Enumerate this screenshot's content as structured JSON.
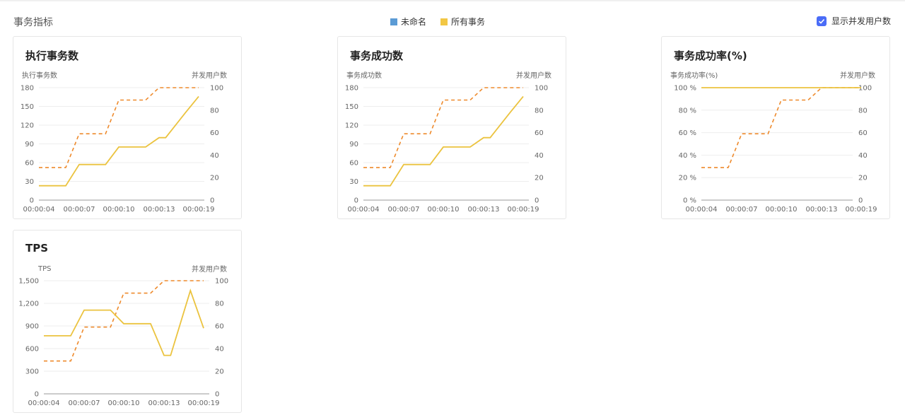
{
  "header": {
    "title": "事务指标",
    "legend": [
      {
        "label": "未命名",
        "color": "#5b9bd5"
      },
      {
        "label": "所有事务",
        "color": "#f2c744"
      }
    ],
    "toggle_label": "显示并发用户数",
    "toggle_checked": true
  },
  "colors": {
    "series_line": "#ebc33f",
    "users_line": "#ee8a2c",
    "grid": "#eeeeee",
    "axis": "#999999"
  },
  "chart_data": [
    {
      "type": "line",
      "title": "执行事务数",
      "ylabel": "执行事务数",
      "y2label": "并发用户数",
      "x": [
        "00:00:04",
        "00:00:07",
        "00:00:10",
        "00:00:13",
        "00:00:19"
      ],
      "ylim": [
        0,
        180
      ],
      "yticks": [
        "0",
        "30",
        "60",
        "90",
        "120",
        "150",
        "180"
      ],
      "y2lim": [
        0,
        100
      ],
      "y2ticks": [
        "0",
        "20",
        "40",
        "60",
        "80",
        "100"
      ],
      "series": {
        "points": [
          [
            4,
            23
          ],
          [
            6,
            23
          ],
          [
            7,
            57
          ],
          [
            9,
            57
          ],
          [
            10,
            85
          ],
          [
            12,
            85
          ],
          [
            13,
            100
          ],
          [
            14,
            100
          ],
          [
            17,
            140
          ],
          [
            19,
            166
          ]
        ]
      },
      "users": {
        "points": [
          [
            4,
            29
          ],
          [
            6,
            29
          ],
          [
            7,
            59
          ],
          [
            9,
            59
          ],
          [
            10,
            89
          ],
          [
            12,
            89
          ],
          [
            13,
            100
          ],
          [
            19,
            100
          ]
        ]
      }
    },
    {
      "type": "line",
      "title": "事务成功数",
      "ylabel": "事务成功数",
      "y2label": "并发用户数",
      "x": [
        "00:00:04",
        "00:00:07",
        "00:00:10",
        "00:00:13",
        "00:00:19"
      ],
      "ylim": [
        0,
        180
      ],
      "yticks": [
        "0",
        "30",
        "60",
        "90",
        "120",
        "150",
        "180"
      ],
      "y2lim": [
        0,
        100
      ],
      "y2ticks": [
        "0",
        "20",
        "40",
        "60",
        "80",
        "100"
      ],
      "series": {
        "points": [
          [
            4,
            23
          ],
          [
            6,
            23
          ],
          [
            7,
            57
          ],
          [
            9,
            57
          ],
          [
            10,
            85
          ],
          [
            12,
            85
          ],
          [
            13,
            100
          ],
          [
            14,
            100
          ],
          [
            17,
            140
          ],
          [
            19,
            166
          ]
        ]
      },
      "users": {
        "points": [
          [
            4,
            29
          ],
          [
            6,
            29
          ],
          [
            7,
            59
          ],
          [
            9,
            59
          ],
          [
            10,
            89
          ],
          [
            12,
            89
          ],
          [
            13,
            100
          ],
          [
            19,
            100
          ]
        ]
      }
    },
    {
      "type": "line",
      "title": "事务成功率(%)",
      "ylabel": "事务成功率(%)",
      "y2label": "并发用户数",
      "x": [
        "00:00:04",
        "00:00:07",
        "00:00:10",
        "00:00:13",
        "00:00:19"
      ],
      "ylim": [
        0,
        100
      ],
      "yticks": [
        "0 %",
        "20 %",
        "40 %",
        "60 %",
        "80 %",
        "100 %"
      ],
      "y2lim": [
        0,
        100
      ],
      "y2ticks": [
        "0",
        "20",
        "40",
        "60",
        "80",
        "100"
      ],
      "series": {
        "points": [
          [
            4,
            100
          ],
          [
            19,
            100
          ]
        ]
      },
      "users": {
        "points": [
          [
            4,
            29
          ],
          [
            6,
            29
          ],
          [
            7,
            59
          ],
          [
            9,
            59
          ],
          [
            10,
            89
          ],
          [
            12,
            89
          ],
          [
            13,
            100
          ],
          [
            19,
            100
          ]
        ]
      }
    },
    {
      "type": "line",
      "title": "TPS",
      "ylabel": "TPS",
      "y2label": "并发用户数",
      "x": [
        "00:00:04",
        "00:00:07",
        "00:00:10",
        "00:00:13",
        "00:00:19"
      ],
      "ylim": [
        0,
        1500
      ],
      "yticks": [
        "0",
        "300",
        "600",
        "900",
        "1,200",
        "1,500"
      ],
      "y2lim": [
        0,
        100
      ],
      "y2ticks": [
        "0",
        "20",
        "40",
        "60",
        "80",
        "100"
      ],
      "series": {
        "points": [
          [
            4,
            770
          ],
          [
            6,
            770
          ],
          [
            7,
            1110
          ],
          [
            9,
            1110
          ],
          [
            10,
            930
          ],
          [
            12,
            930
          ],
          [
            13,
            510
          ],
          [
            14,
            510
          ],
          [
            17,
            1370
          ],
          [
            19,
            870
          ]
        ]
      },
      "users": {
        "points": [
          [
            4,
            29
          ],
          [
            6,
            29
          ],
          [
            7,
            59
          ],
          [
            9,
            59
          ],
          [
            10,
            89
          ],
          [
            12,
            89
          ],
          [
            13,
            100
          ],
          [
            19,
            100
          ]
        ]
      }
    }
  ]
}
